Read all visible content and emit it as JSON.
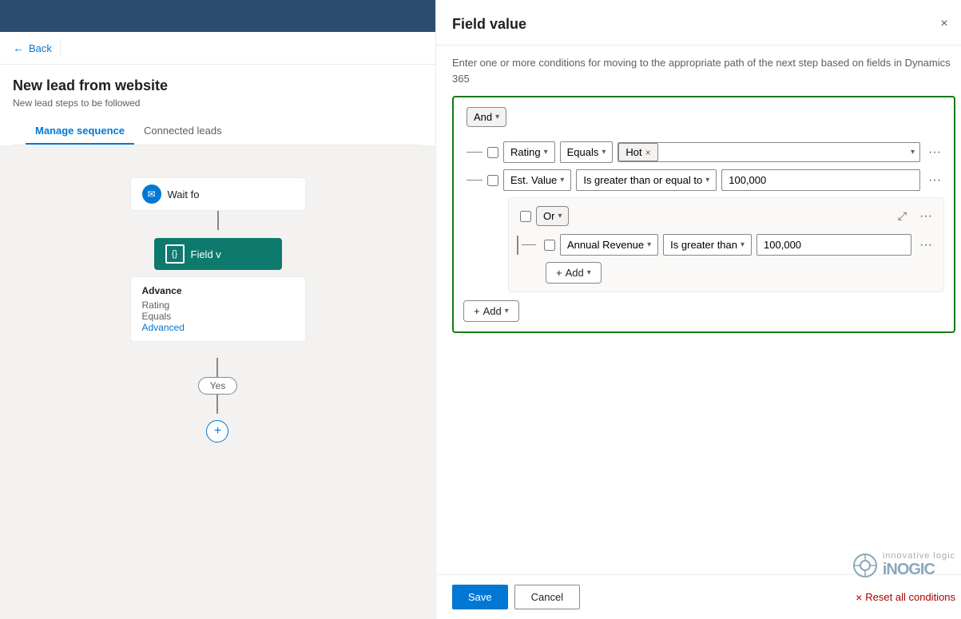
{
  "app": {
    "top_bar_color": "#2d4d6e"
  },
  "left_panel": {
    "back_label": "Back",
    "page_title": "New lead from website",
    "page_subtitle": "New lead steps to be followed",
    "tabs": [
      {
        "label": "Manage sequence",
        "active": true
      },
      {
        "label": "Connected leads",
        "active": false
      }
    ],
    "wait_node_label": "Wait fo",
    "field_node_label": "Field v",
    "advanced_section": {
      "rating_label": "Rating",
      "equals_label": "Equals",
      "advanced_link": "Advanced"
    },
    "yes_badge": "Yes",
    "add_label": "+"
  },
  "modal": {
    "title": "Field value",
    "description": "Enter one or more conditions for moving to the appropriate path of the next step based on fields in Dynamics 365",
    "close_label": "×",
    "logic_operator": "And",
    "conditions": [
      {
        "field": "Rating",
        "operator": "Equals",
        "value_tag": "Hot",
        "value_type": "tag"
      },
      {
        "field": "Est. Value",
        "operator": "Is greater than or equal to",
        "value": "100,000",
        "value_type": "text"
      }
    ],
    "nested_group": {
      "logic_operator": "Or",
      "conditions": [
        {
          "field": "Annual Revenue",
          "operator": "Is greater than",
          "value": "100,000",
          "value_type": "text"
        }
      ],
      "add_label": "+ Add"
    },
    "outer_add_label": "+ Add",
    "footer": {
      "save_label": "Save",
      "cancel_label": "Cancel",
      "reset_label": "Reset all conditions"
    },
    "watermark": {
      "brand": "iNOGIC",
      "tagline": "innovative logic"
    }
  }
}
